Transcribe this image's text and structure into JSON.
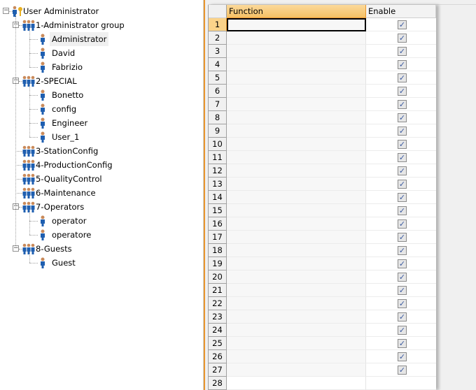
{
  "tree": {
    "root": "User Administrator",
    "groups": [
      {
        "label": "1-Administrator group",
        "users": [
          "Administrator",
          "David",
          "Fabrizio"
        ]
      },
      {
        "label": "2-SPECIAL",
        "users": [
          "Bonetto",
          "config",
          "Engineer",
          "User_1"
        ]
      },
      {
        "label": "3-StationConfig",
        "users": []
      },
      {
        "label": "4-ProductionConfig",
        "users": []
      },
      {
        "label": "5-QualityControl",
        "users": []
      },
      {
        "label": "6-Maintenance",
        "users": []
      },
      {
        "label": "7-Operators",
        "users": [
          "operator",
          "operatore"
        ]
      },
      {
        "label": "8-Guests",
        "users": [
          "Guest"
        ]
      }
    ],
    "selected": "Administrator"
  },
  "grid": {
    "columns": [
      "Function",
      "Enable"
    ],
    "rows": [
      {
        "n": "1",
        "function": "",
        "enable": true
      },
      {
        "n": "2",
        "function": "",
        "enable": true
      },
      {
        "n": "3",
        "function": "",
        "enable": true
      },
      {
        "n": "4",
        "function": "",
        "enable": true
      },
      {
        "n": "5",
        "function": "",
        "enable": true
      },
      {
        "n": "6",
        "function": "",
        "enable": true
      },
      {
        "n": "7",
        "function": "",
        "enable": true
      },
      {
        "n": "8",
        "function": "",
        "enable": true
      },
      {
        "n": "9",
        "function": "",
        "enable": true
      },
      {
        "n": "10",
        "function": "",
        "enable": true
      },
      {
        "n": "11",
        "function": "",
        "enable": true
      },
      {
        "n": "12",
        "function": "",
        "enable": true
      },
      {
        "n": "13",
        "function": "",
        "enable": true
      },
      {
        "n": "14",
        "function": "",
        "enable": true
      },
      {
        "n": "15",
        "function": "",
        "enable": true
      },
      {
        "n": "16",
        "function": "",
        "enable": true
      },
      {
        "n": "17",
        "function": "",
        "enable": true
      },
      {
        "n": "18",
        "function": "",
        "enable": true
      },
      {
        "n": "19",
        "function": "",
        "enable": true
      },
      {
        "n": "20",
        "function": "",
        "enable": true
      },
      {
        "n": "21",
        "function": "",
        "enable": true
      },
      {
        "n": "22",
        "function": "",
        "enable": true
      },
      {
        "n": "23",
        "function": "",
        "enable": true
      },
      {
        "n": "24",
        "function": "",
        "enable": true
      },
      {
        "n": "25",
        "function": "",
        "enable": true
      },
      {
        "n": "26",
        "function": "",
        "enable": true
      },
      {
        "n": "27",
        "function": "",
        "enable": true
      },
      {
        "n": "28",
        "function": "",
        "enable": null
      }
    ]
  },
  "colors": {
    "accent": "#e8962e",
    "header": "#f7c66e",
    "checkbox": "#3a5aa0"
  }
}
